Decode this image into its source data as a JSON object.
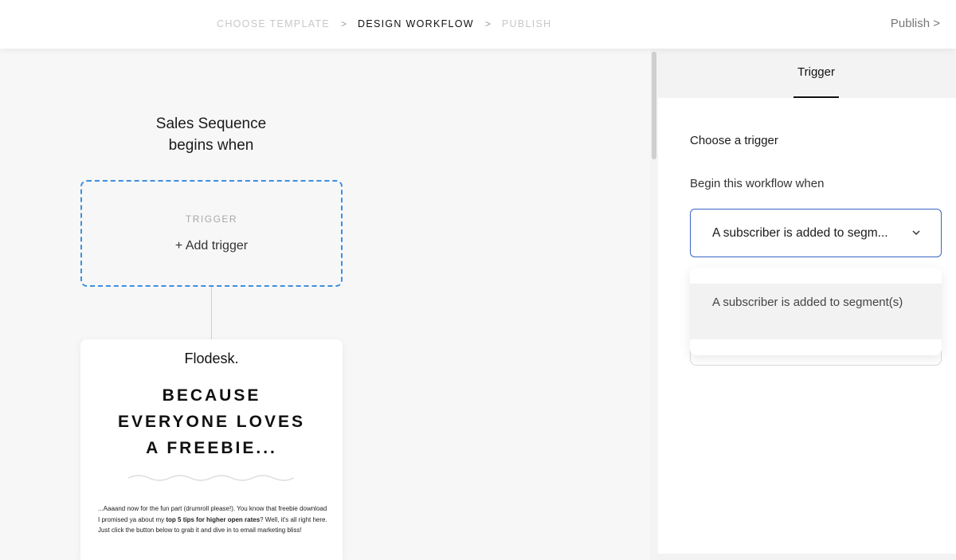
{
  "header": {
    "steps": [
      {
        "label": "CHOOSE TEMPLATE",
        "active": false
      },
      {
        "label": "DESIGN WORKFLOW",
        "active": true
      },
      {
        "label": "PUBLISH",
        "active": false
      }
    ],
    "separator": ">",
    "publish_label": "Publish >"
  },
  "canvas": {
    "title_line1": "Sales Sequence",
    "title_line2": "begins when",
    "trigger": {
      "label": "TRIGGER",
      "add_label": "+ Add trigger"
    },
    "email": {
      "logo": "Flodesk.",
      "headline_lines": [
        "BECAUSE",
        "EVERYONE LOVES",
        "A FREEBIE..."
      ],
      "body_before": "...Aaaand now for the fun part (drumroll please!). You know that freebie download I promised ya about my ",
      "body_bold": "top 5 tips for higher open rates",
      "body_after": "? Well, it's all right here. Just click the button below to grab it and dive in to email marketing bliss!"
    }
  },
  "panel": {
    "tab_label": "Trigger",
    "section_title": "Choose a trigger",
    "field_label": "Begin this workflow when",
    "select_value": "A subscriber is added to segm...",
    "options": [
      "A subscriber is added to segment(s)"
    ]
  },
  "colors": {
    "accent_dashed": "#3d8fe0",
    "select_border": "#3a66c4"
  }
}
